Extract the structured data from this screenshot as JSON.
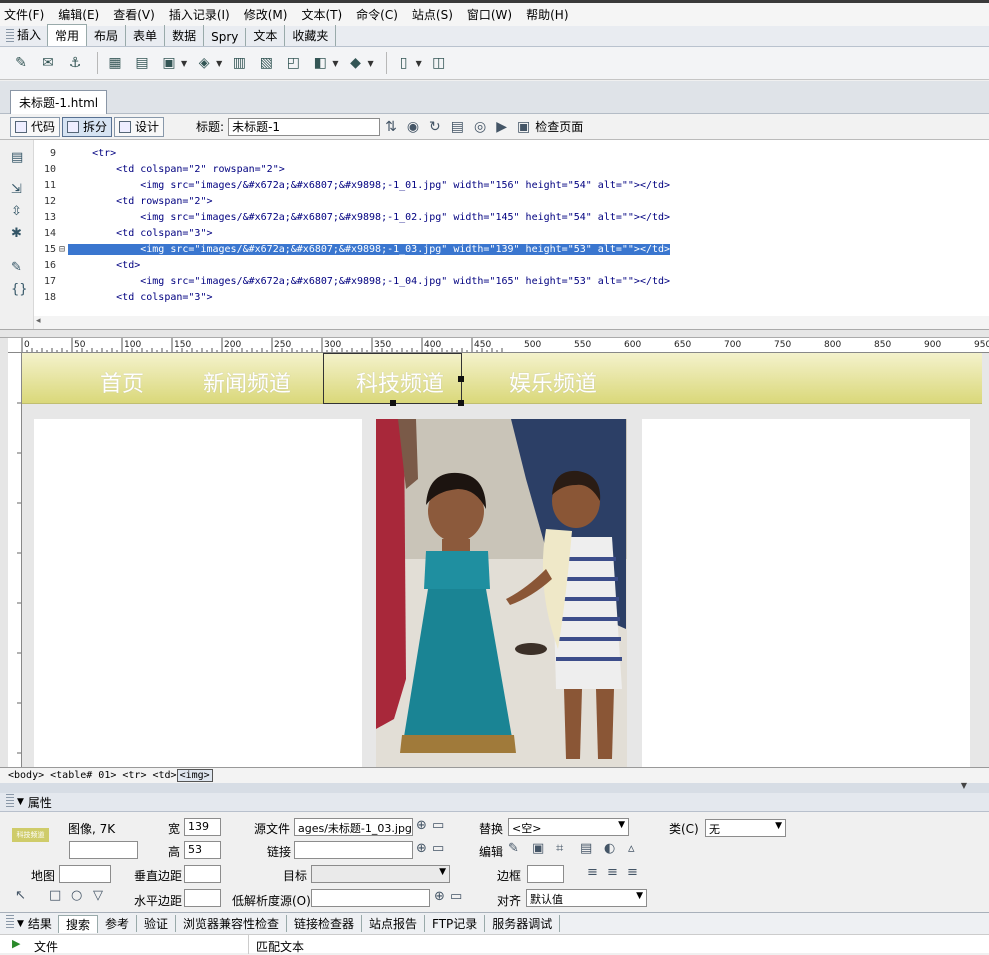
{
  "menu": [
    "文件(F)",
    "编辑(E)",
    "查看(V)",
    "插入记录(I)",
    "修改(M)",
    "文本(T)",
    "命令(C)",
    "站点(S)",
    "窗口(W)",
    "帮助(H)"
  ],
  "insert_panel": {
    "label": "插入",
    "tabs": [
      "常用",
      "布局",
      "表单",
      "数据",
      "Spry",
      "文本",
      "收藏夹"
    ]
  },
  "document": {
    "tab_title": "未标题-1.html",
    "view_code": "代码",
    "view_split": "拆分",
    "view_design": "设计",
    "title_label": "标题:",
    "title_value": "未标题-1",
    "check_page": "检查页面"
  },
  "code": {
    "lines": [
      {
        "num": "9",
        "text": "    <tr>"
      },
      {
        "num": "10",
        "text": "        <td colspan=\"2\" rowspan=\"2\">"
      },
      {
        "num": "11",
        "text": "            <img src=\"images/&#x672a;&#x6807;&#x9898;-1_01.jpg\" width=\"156\" height=\"54\" alt=\"\"></td>"
      },
      {
        "num": "12",
        "text": "        <td rowspan=\"2\">"
      },
      {
        "num": "13",
        "text": "            <img src=\"images/&#x672a;&#x6807;&#x9898;-1_02.jpg\" width=\"145\" height=\"54\" alt=\"\"></td>"
      },
      {
        "num": "14",
        "text": "        <td colspan=\"3\">"
      },
      {
        "num": "15",
        "text": "            <img src=\"images/&#x672a;&#x6807;&#x9898;-1_03.jpg\" width=\"139\" height=\"53\" alt=\"\"></td>"
      },
      {
        "num": "16",
        "text": "        <td>"
      },
      {
        "num": "17",
        "text": "            <img src=\"images/&#x672a;&#x6807;&#x9898;-1_04.jpg\" width=\"165\" height=\"53\" alt=\"\"></td>"
      },
      {
        "num": "18",
        "text": "        <td colspan=\"3\">"
      }
    ]
  },
  "ruler_ticks": [
    "0",
    "50",
    "100",
    "150",
    "200",
    "250",
    "300",
    "350",
    "400",
    "450",
    "500",
    "550",
    "600",
    "650",
    "700",
    "750",
    "800",
    "850",
    "900",
    "950"
  ],
  "design": {
    "nav": [
      "首页",
      "新闻频道",
      "科技频道",
      "娱乐频道"
    ]
  },
  "tag_selector": {
    "path": "<body> <table# 01> <tr> <td>",
    "current": "<img>"
  },
  "properties": {
    "title": "属性",
    "type_label": "图像, 7K",
    "thumb_text": "科技频道",
    "width_label": "宽",
    "width_value": "139",
    "height_label": "高",
    "height_value": "53",
    "src_label": "源文件",
    "src_value": "ages/未标题-1_03.jpg",
    "link_label": "链接",
    "alt_label": "替换",
    "alt_value": "<空>",
    "class_label": "类(C)",
    "class_value": "无",
    "edit_label": "编辑",
    "map_label": "地图",
    "vspace_label": "垂直边距",
    "hspace_label": "水平边距",
    "target_label": "目标",
    "lowsrc_label": "低解析度源(O)",
    "border_label": "边框",
    "align_label": "对齐",
    "align_value": "默认值"
  },
  "results": {
    "title": "结果",
    "tabs": [
      "搜索",
      "参考",
      "验证",
      "浏览器兼容性检查",
      "链接检查器",
      "站点报告",
      "FTP记录",
      "服务器调试"
    ],
    "col_file": "文件",
    "col_match": "匹配文本"
  }
}
